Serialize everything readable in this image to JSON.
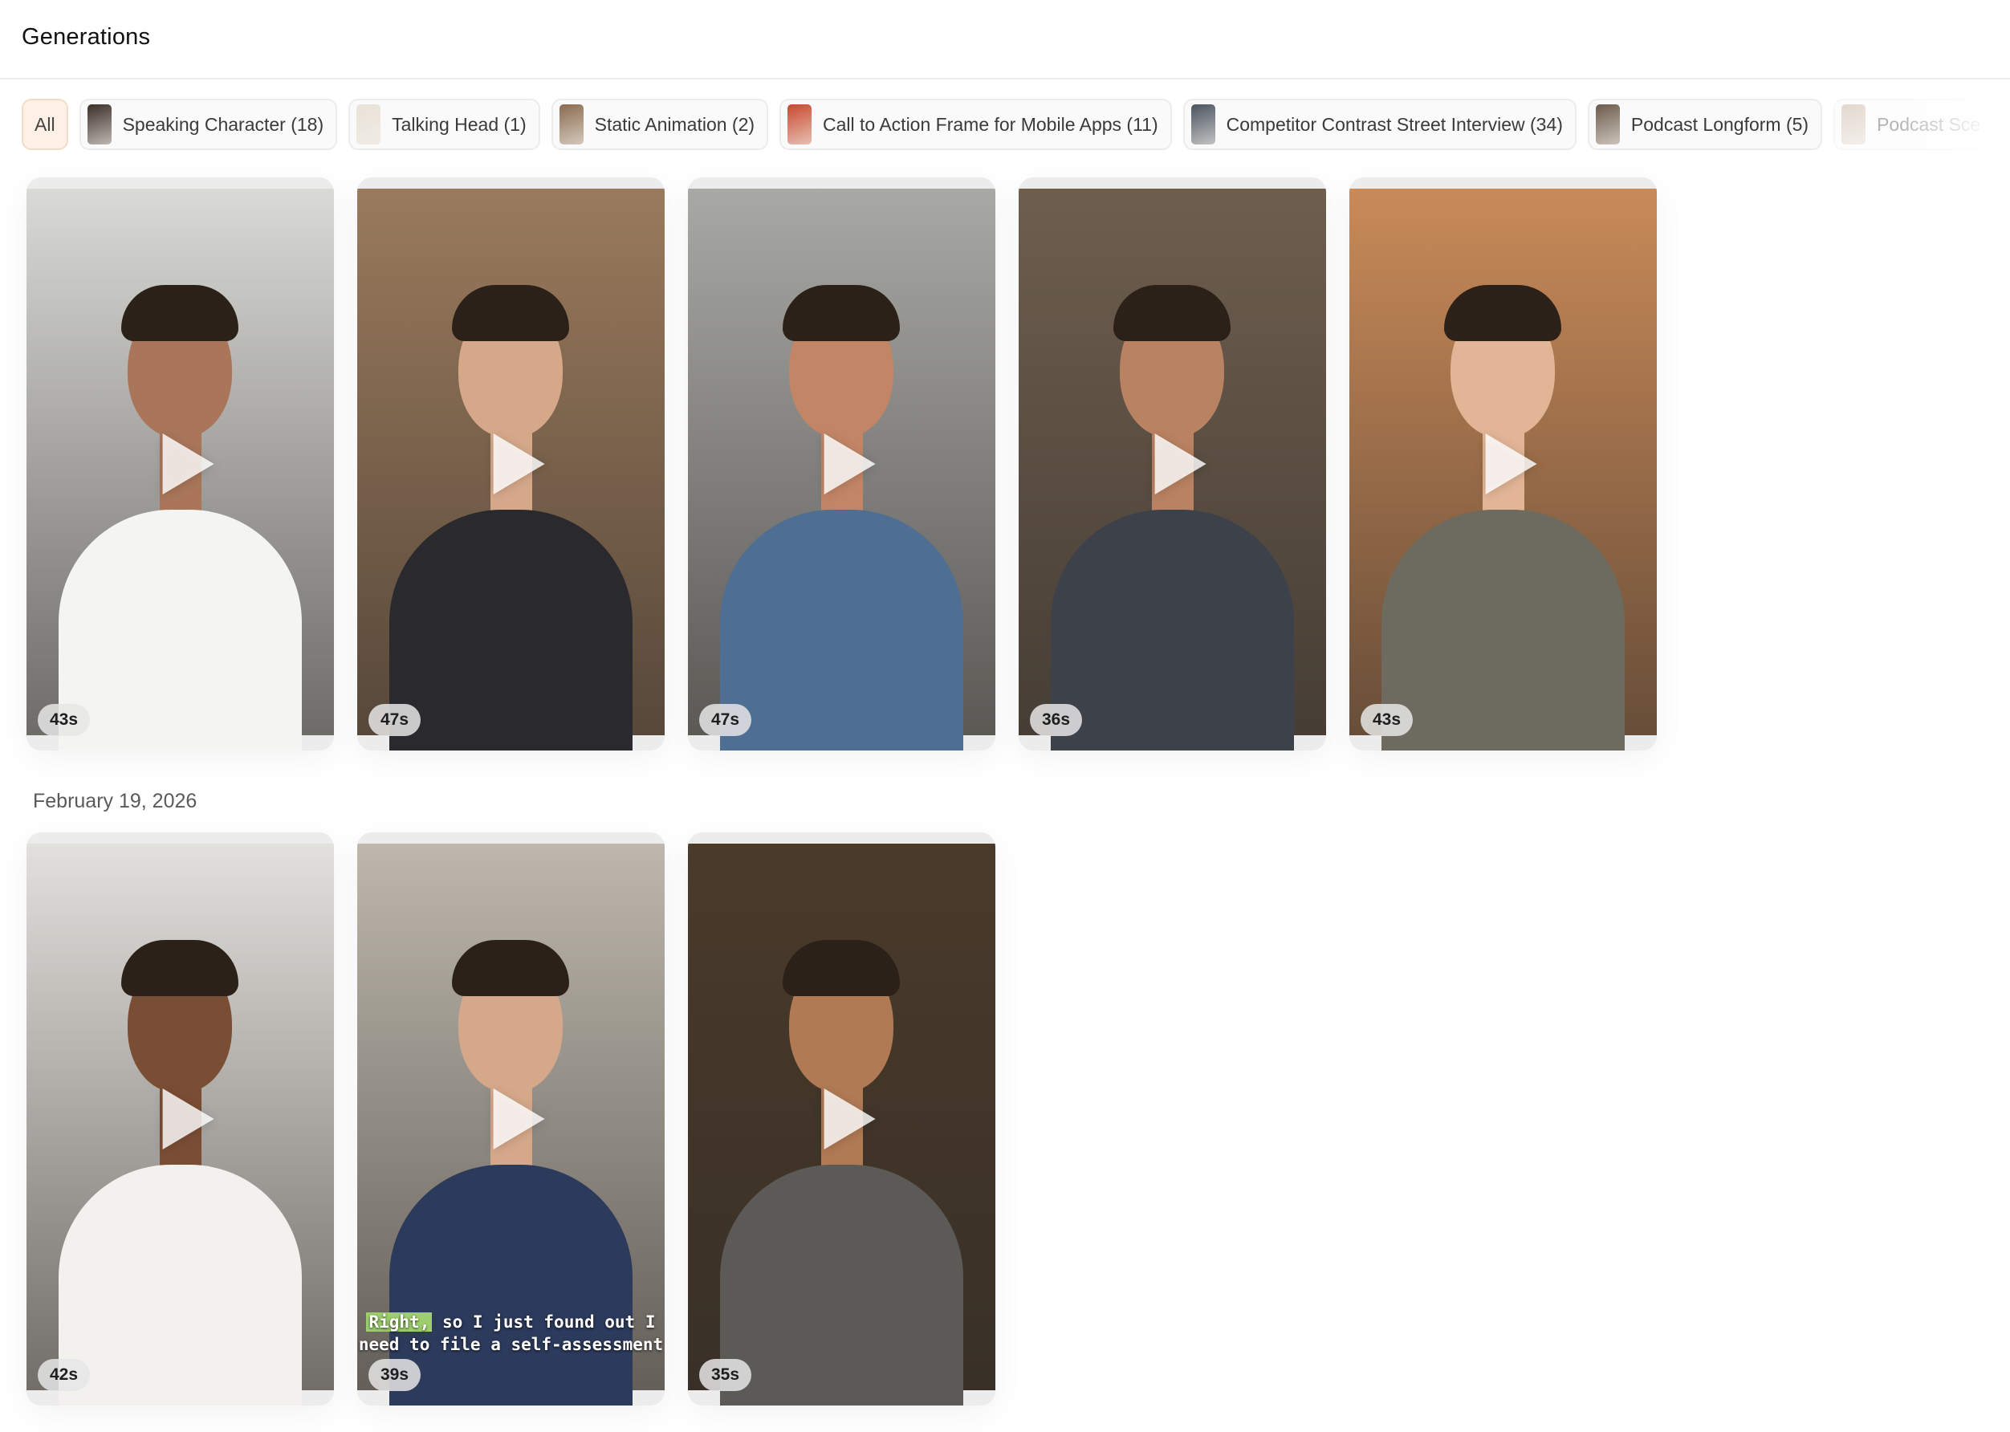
{
  "header": {
    "title": "Generations"
  },
  "filters": [
    {
      "label": "All",
      "selected": true
    },
    {
      "label": "Speaking Character (18)",
      "thumb_color": "#3b2e27"
    },
    {
      "label": "Talking Head (1)",
      "thumb_color": "#e9e2d8"
    },
    {
      "label": "Static Animation (2)",
      "thumb_color": "#8a6a4e"
    },
    {
      "label": "Call to Action Frame for Mobile Apps (11)",
      "thumb_color": "#c9482e"
    },
    {
      "label": "Competitor Contrast Street Interview (34)",
      "thumb_color": "#4a5360"
    },
    {
      "label": "Podcast Longform (5)",
      "thumb_color": "#6b5a4b"
    },
    {
      "label": "Podcast Sce",
      "thumb_color": "#b59a82"
    }
  ],
  "section1": {
    "videos": [
      {
        "duration": "43s",
        "bg": "#d9d9d6",
        "skin": "#a9765a",
        "shirt": "#f4f4f2"
      },
      {
        "duration": "47s",
        "bg": "#9a7a5c",
        "skin": "#d6a88a",
        "shirt": "#2a2a2e"
      },
      {
        "duration": "47s",
        "bg": "#a8a8a4",
        "skin": "#c28566",
        "shirt": "#4f6e93"
      },
      {
        "duration": "36s",
        "bg": "#6e5e4e",
        "skin": "#b98262",
        "shirt": "#3c414a"
      },
      {
        "duration": "43s",
        "bg": "#c98a58",
        "skin": "#e2b596",
        "shirt": "#6d6a5f"
      }
    ]
  },
  "section2": {
    "date": "February 19, 2026",
    "videos": [
      {
        "duration": "42s",
        "bg": "#e2e0dc",
        "skin": "#7a4e34",
        "shirt": "#f2f1ee"
      },
      {
        "duration": "39s",
        "bg": "#bdb7ad",
        "skin": "#d6a88a",
        "shirt": "#2c3a5c",
        "caption_highlight": "Right,",
        "caption_line1": " so I just found out I",
        "caption_line2": "need to file a self-assessment"
      },
      {
        "duration": "35s",
        "bg": "#4a3a2a",
        "skin": "#b07a55",
        "shirt": "#5b5a57"
      }
    ]
  }
}
